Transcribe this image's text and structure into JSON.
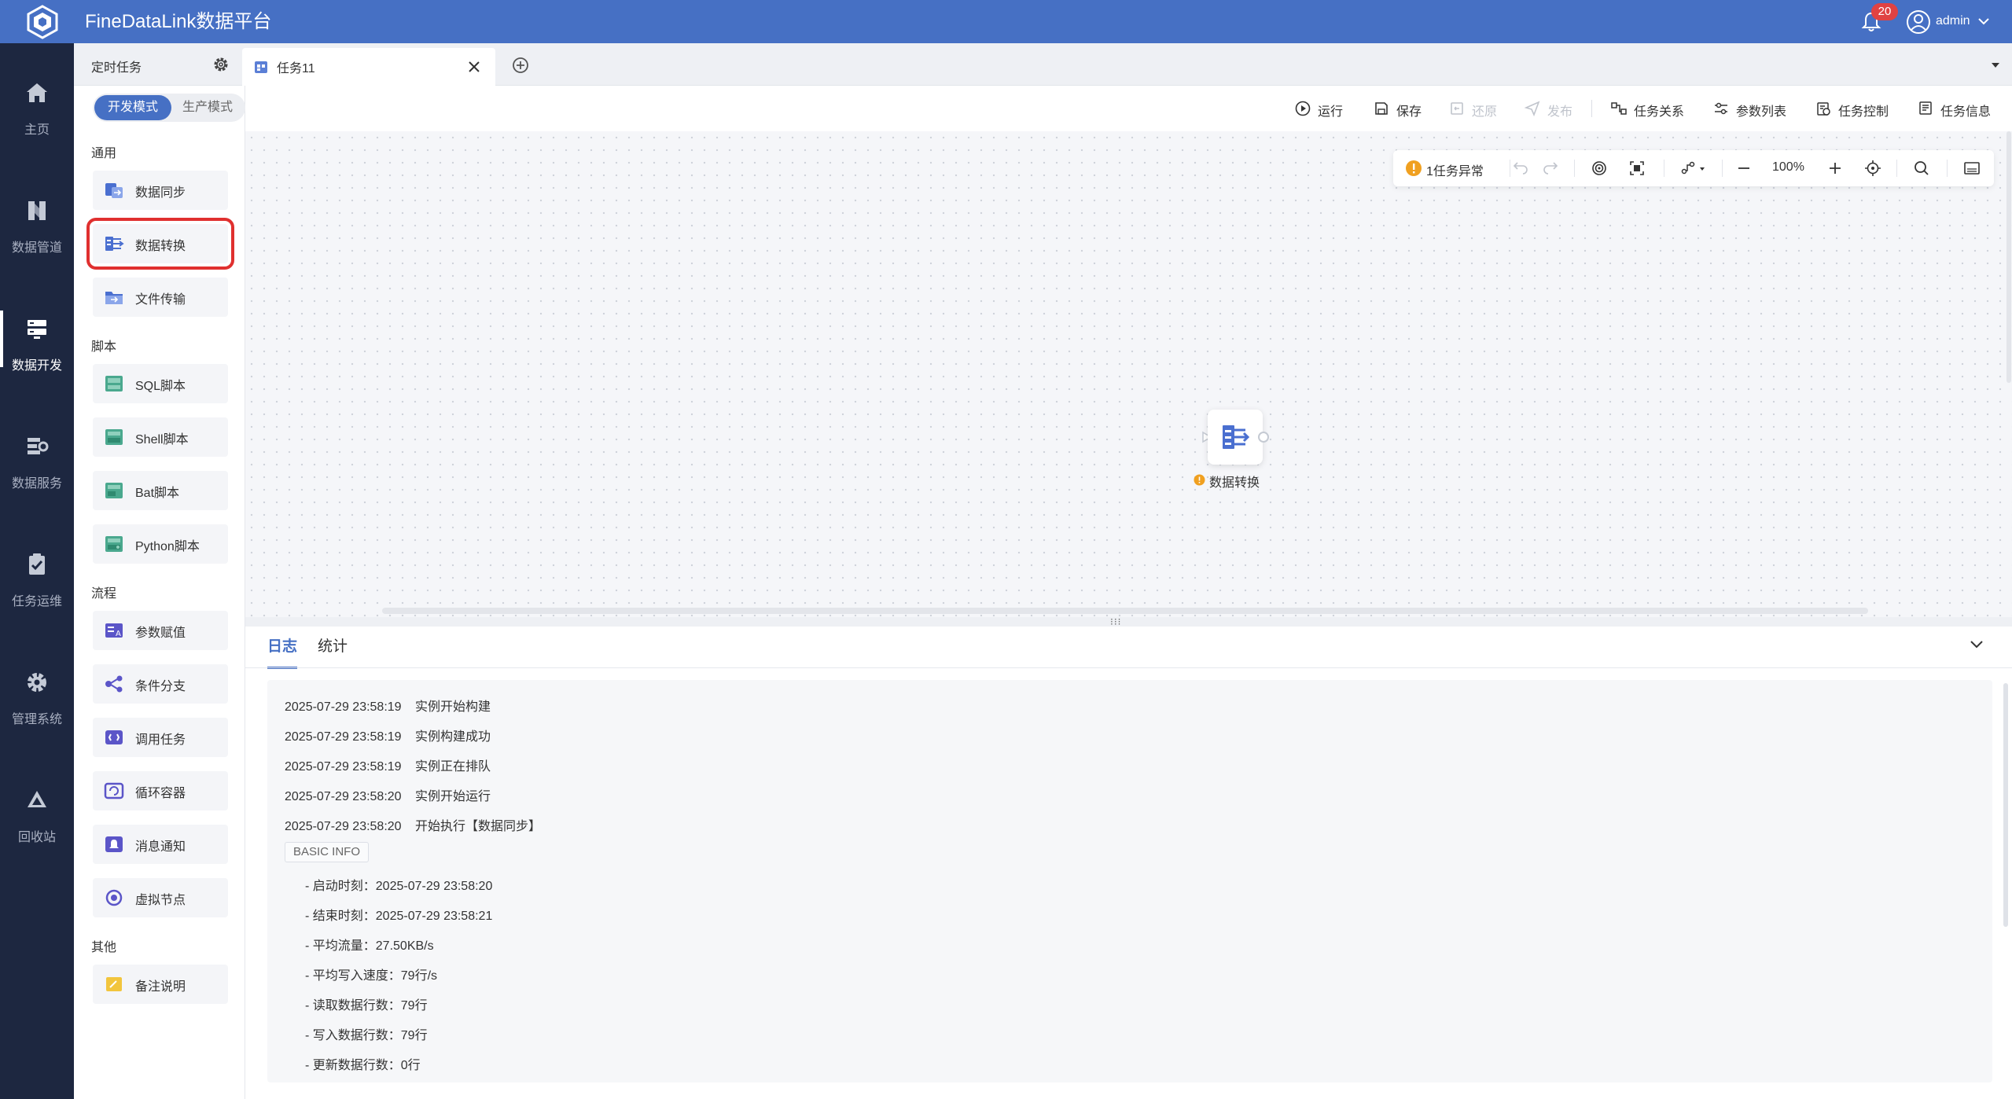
{
  "topbar": {
    "title": "FineDataLink数据平台",
    "notification_count": "20",
    "username": "admin",
    "accent": "#4670c4",
    "badge_color": "#e04242"
  },
  "leftnav": {
    "items": [
      {
        "label": "主页",
        "icon": "home-icon"
      },
      {
        "label": "数据管道",
        "icon": "pipeline-icon"
      },
      {
        "label": "数据开发",
        "icon": "data-dev-icon",
        "active": true
      },
      {
        "label": "数据服务",
        "icon": "data-service-icon"
      },
      {
        "label": "任务运维",
        "icon": "task-ops-icon"
      },
      {
        "label": "管理系统",
        "icon": "gear-icon"
      },
      {
        "label": "回收站",
        "icon": "recycle-icon"
      }
    ]
  },
  "tabs": {
    "fixed_label": "定时任务",
    "active_label": "任务11"
  },
  "panel": {
    "mode_dev": "开发模式",
    "mode_prod": "生产模式",
    "sections": [
      {
        "title": "通用",
        "items": [
          "数据同步",
          "数据转换",
          "文件传输"
        ]
      },
      {
        "title": "脚本",
        "items": [
          "SQL脚本",
          "Shell脚本",
          "Bat脚本",
          "Python脚本"
        ]
      },
      {
        "title": "流程",
        "items": [
          "参数赋值",
          "条件分支",
          "调用任务",
          "循环容器",
          "消息通知",
          "虚拟节点"
        ]
      },
      {
        "title": "其他",
        "items": [
          "备注说明"
        ]
      }
    ],
    "highlighted_item": "数据转换"
  },
  "toolbar": {
    "run": "运行",
    "save": "保存",
    "restore": "还原",
    "publish": "发布",
    "task_relation": "任务关系",
    "param_list": "参数列表",
    "task_control": "任务控制",
    "task_info": "任务信息"
  },
  "canvas": {
    "warning": "1任务异常",
    "zoom": "100%",
    "node_label": "数据转换"
  },
  "log": {
    "tab_log": "日志",
    "tab_stats": "统计",
    "lines": [
      {
        "time": "2025-07-29 23:58:19",
        "msg": "实例开始构建"
      },
      {
        "time": "2025-07-29 23:58:19",
        "msg": "实例构建成功"
      },
      {
        "time": "2025-07-29 23:58:19",
        "msg": "实例正在排队"
      },
      {
        "time": "2025-07-29 23:58:20",
        "msg": "实例开始运行"
      },
      {
        "time": "2025-07-29 23:58:20",
        "msg": "开始执行【数据同步】"
      }
    ],
    "basic_info": "BASIC INFO",
    "details": [
      "- 启动时刻：2025-07-29 23:58:20",
      "- 结束时刻：2025-07-29 23:58:21",
      "- 平均流量：27.50KB/s",
      "- 平均写入速度：79行/s",
      "- 读取数据行数：79行",
      "- 写入数据行数：79行",
      "- 更新数据行数：0行"
    ]
  }
}
